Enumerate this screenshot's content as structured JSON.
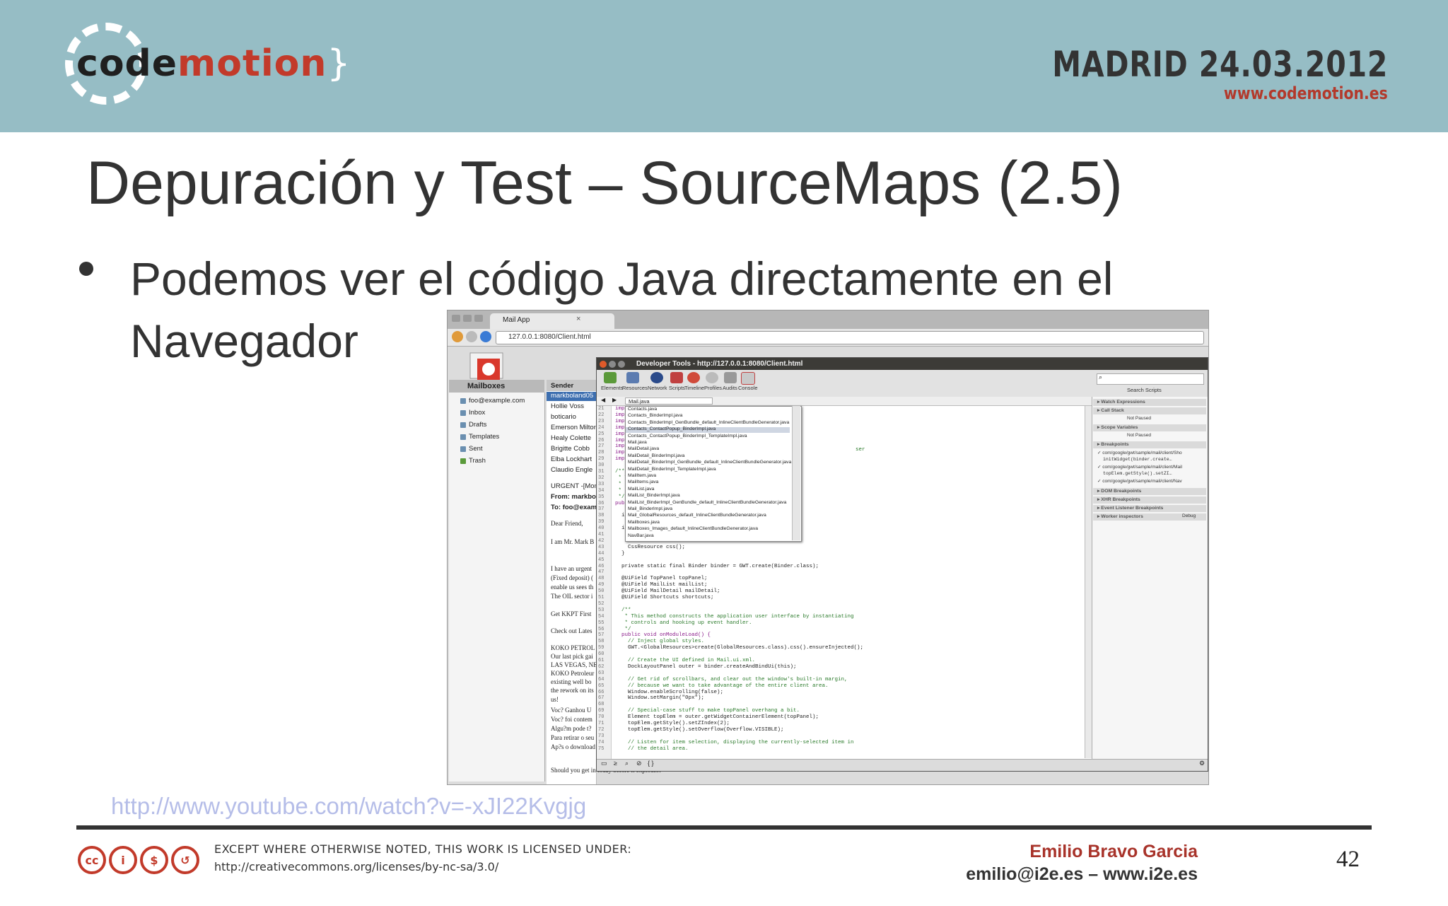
{
  "header": {
    "logo": "codemotion",
    "event_date": "MADRID 24.03.2012",
    "event_url": "www.codemotion.es"
  },
  "slide": {
    "title": "Depuración y Test – SourceMaps (2.5)",
    "bullet_line1": "Podemos ver el código Java directamente en el",
    "bullet_line2": "Navegador"
  },
  "browser": {
    "tab_title": "Mail App",
    "url": "127.0.0.1:8080/Client.html",
    "mailboxes_header": "Mailboxes",
    "mailboxes": [
      "foo@example.com",
      "Inbox",
      "Drafts",
      "Templates",
      "Sent",
      "Trash"
    ],
    "sender_header": "Sender",
    "senders": [
      "markboland05",
      "Hollie Voss",
      "boticario",
      "Emerson Milton",
      "Healy Colette",
      "Brigitte Cobb",
      "Elba Lockhart",
      "Claudio Engle"
    ],
    "message_subject": "URGENT -[Mon",
    "message_from": "From: markbola",
    "message_to": "To: foo@examp",
    "message_lines": [
      "Dear Friend,",
      "I am Mr. Mark B",
      "I have an urgent",
      "(Fixed deposit) (",
      "enable us sees th",
      "The OIL sector i",
      "Get KKPT First",
      "Check out Lates",
      "KOKO PETROL",
      "Our last pick gai",
      "LAS VEGAS, NE",
      "KOKO Petroleur",
      "existing well bo",
      "the rework on its",
      "us!",
      "Voc? Ganhou U",
      "Voc? foi contem",
      "Algu?m pode t?",
      "Para retirar o seu",
      "Ap?s o download",
      "Should you get in today before it explodes?"
    ]
  },
  "devtools": {
    "title": "Developer Tools - http://127.0.0.1:8080/Client.html",
    "panels": [
      "Elements",
      "Resources",
      "Network",
      "Scripts",
      "Timeline",
      "Profiles",
      "Audits",
      "Console"
    ],
    "search_label": "Search Scripts",
    "selected_file": "Mail.java",
    "file_list": [
      "Contacts.java",
      "Contacts_BinderImpl.java",
      "Contacts_BinderImpl_GenBundle_default_InlineClientBundleGenerator.java",
      "Contacts_ContactPopup_BinderImpl.java",
      "Contacts_ContactPopup_BinderImpl_TemplateImpl.java",
      "Mail.java",
      "MailDetail.java",
      "MailDetail_BinderImpl.java",
      "MailDetail_BinderImpl_GenBundle_default_InlineClientBundleGenerator.java",
      "MailDetail_BinderImpl_TemplateImpl.java",
      "MailItem.java",
      "MailItems.java",
      "MailList.java",
      "MailList_BinderImpl.java",
      "MailList_BinderImpl_GenBundle_default_InlineClientBundleGenerator.java",
      "Mail_BinderImpl.java",
      "Mail_GlobalResources_default_InlineClientBundleGenerator.java",
      "Mailboxes.java",
      "Mailboxes_Images_default_InlineClientBundleGenerator.java",
      "NavBar.java"
    ],
    "line_numbers": [
      "21",
      "22",
      "23",
      "24",
      "25",
      "26",
      "27",
      "28",
      "29",
      "30",
      "31",
      "32",
      "33",
      "34",
      "35",
      "36",
      "37",
      "38",
      "39",
      "40",
      "41",
      "42",
      "43",
      "44",
      "45",
      "46",
      "47",
      "48",
      "49",
      "50",
      "51",
      "52",
      "53",
      "54",
      "55",
      "56",
      "57",
      "58",
      "59",
      "60",
      "61",
      "62",
      "63",
      "64",
      "65",
      "66",
      "67",
      "68",
      "69",
      "70",
      "71",
      "72",
      "73",
      "74",
      "75"
    ],
    "code_lines": [
      {
        "t": "impor",
        "c": "kw"
      },
      {
        "t": "impor",
        "c": "kw"
      },
      {
        "t": "impor",
        "c": "kw"
      },
      {
        "t": "impor",
        "c": "kw"
      },
      {
        "t": "impor",
        "c": "kw"
      },
      {
        "t": "impor",
        "c": "kw"
      },
      {
        "t": "impor",
        "c": "kw"
      },
      {
        "t": "impor",
        "c": "kw"
      },
      {
        "t": "impor",
        "c": "kw"
      },
      {
        "t": "",
        "c": ""
      },
      {
        "t": "/**",
        "c": "cm"
      },
      {
        "t": " * Th",
        "c": "cm"
      },
      {
        "t": " * in",
        "c": "cm"
      },
      {
        "t": " * po",
        "c": "cm"
      },
      {
        "t": " */",
        "c": "cm"
      },
      {
        "t": "publi",
        "c": "kw"
      },
      {
        "t": "",
        "c": ""
      },
      {
        "t": "  int",
        "c": ""
      },
      {
        "t": "",
        "c": ""
      },
      {
        "t": "  int",
        "c": ""
      },
      {
        "t": "    @",
        "c": ""
      },
      {
        "t": "    C",
        "c": ""
      },
      {
        "t": "    CssResource css();",
        "c": ""
      },
      {
        "t": "  }",
        "c": ""
      },
      {
        "t": "",
        "c": ""
      },
      {
        "t": "  private static final Binder binder = GWT.create(Binder.class);",
        "c": ""
      },
      {
        "t": "",
        "c": ""
      },
      {
        "t": "  @UiField TopPanel topPanel;",
        "c": ""
      },
      {
        "t": "  @UiField MailList mailList;",
        "c": ""
      },
      {
        "t": "  @UiField MailDetail mailDetail;",
        "c": ""
      },
      {
        "t": "  @UiField Shortcuts shortcuts;",
        "c": ""
      },
      {
        "t": "",
        "c": ""
      },
      {
        "t": "  /**",
        "c": "cm"
      },
      {
        "t": "   * This method constructs the application user interface by instantiating",
        "c": "cm"
      },
      {
        "t": "   * controls and hooking up event handler.",
        "c": "cm"
      },
      {
        "t": "   */",
        "c": "cm"
      },
      {
        "t": "  public void onModuleLoad() {",
        "c": "kw"
      },
      {
        "t": "    // Inject global styles.",
        "c": "cm"
      },
      {
        "t": "    GWT.<GlobalResources>create(GlobalResources.class).css().ensureInjected();",
        "c": ""
      },
      {
        "t": "",
        "c": ""
      },
      {
        "t": "    // Create the UI defined in Mail.ui.xml.",
        "c": "cm"
      },
      {
        "t": "    DockLayoutPanel outer = binder.createAndBindUi(this);",
        "c": ""
      },
      {
        "t": "",
        "c": ""
      },
      {
        "t": "    // Get rid of scrollbars, and clear out the window's built-in margin,",
        "c": "cm"
      },
      {
        "t": "    // because we want to take advantage of the entire client area.",
        "c": "cm"
      },
      {
        "t": "    Window.enableScrolling(false);",
        "c": ""
      },
      {
        "t": "    Window.setMargin(\"0px\");",
        "c": ""
      },
      {
        "t": "",
        "c": ""
      },
      {
        "t": "    // Special-case stuff to make topPanel overhang a bit.",
        "c": "cm"
      },
      {
        "t": "    Element topElem = outer.getWidgetContainerElement(topPanel);",
        "c": ""
      },
      {
        "t": "    topElem.getStyle().setZIndex(2);",
        "c": ""
      },
      {
        "t": "    topElem.getStyle().setOverflow(Overflow.VISIBLE);",
        "c": ""
      },
      {
        "t": "",
        "c": ""
      },
      {
        "t": "    // Listen for item selection, displaying the currently-selected item in",
        "c": "cm"
      },
      {
        "t": "    // the detail area.",
        "c": "cm"
      }
    ],
    "code_overflow_text": "ser",
    "right_sections": [
      {
        "head": "Watch Expressions"
      },
      {
        "head": "Call Stack",
        "body": "Not Paused"
      },
      {
        "head": "Scope Variables",
        "body": "Not Paused"
      },
      {
        "head": "Breakpoints"
      }
    ],
    "breakpoints": [
      "com/google/gwt/sample/mail/client/Sho",
      "initWidget(binder.create…",
      "com/google/gwt/sample/mail/client/Mail",
      "topElem.getStyle().setZI…",
      "com/google/gwt/sample/mail/client/Nav"
    ],
    "more_sections": [
      "DOM Breakpoints",
      "XHR Breakpoints",
      "Event Listener Breakpoints",
      "Worker inspectors"
    ],
    "debug_label": "Debug"
  },
  "link": "http://www.youtube.com/watch?v=-xJI22Kvgjg",
  "footer": {
    "license_line1": "EXCEPT WHERE OTHERWISE NOTED, THIS WORK IS LICENSED UNDER:",
    "license_line2": "http://creativecommons.org/licenses/by-nc-sa/3.0/",
    "author": "Emilio Bravo Garcia",
    "author_contact": "emilio@i2e.es – www.i2e.es",
    "page_number": "42",
    "cc_icons": [
      "cc-icon",
      "by-icon",
      "nc-icon",
      "sa-icon"
    ]
  },
  "colors": {
    "header_bg": "#96bdc5",
    "accent_red": "#c23a2a",
    "link": "#b5bde8"
  }
}
